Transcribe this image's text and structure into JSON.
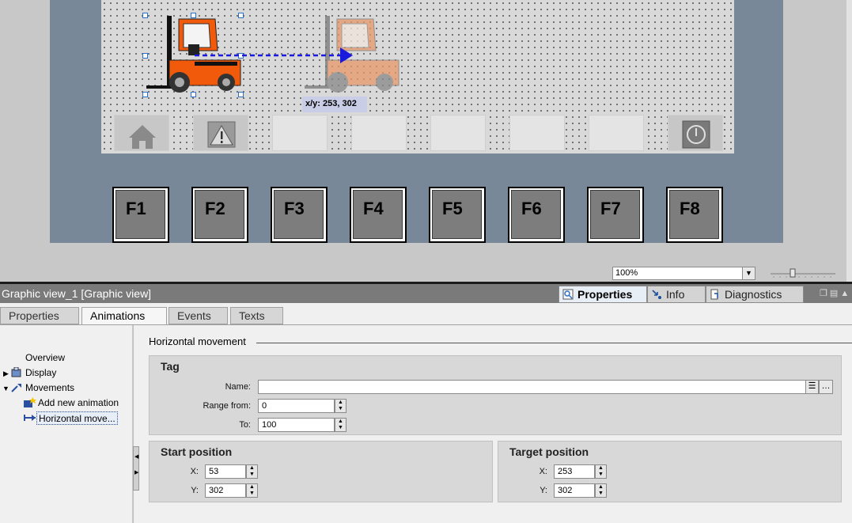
{
  "canvas": {
    "coordinate_readout": "x/y: 253, 302",
    "function_keys": [
      "F1",
      "F2",
      "F3",
      "F4",
      "F5",
      "F6",
      "F7",
      "F8"
    ],
    "soft_key_icons": [
      "home-icon",
      "warning-icon",
      "",
      "",
      "",
      "",
      "",
      "power-icon"
    ],
    "zoom_value": "100%"
  },
  "inspector": {
    "title": "Graphic view_1 [Graphic view]",
    "top_tabs": {
      "properties": "Properties",
      "info": "Info",
      "diagnostics": "Diagnostics"
    },
    "sub_tabs": {
      "properties": "Properties",
      "animations": "Animations",
      "events": "Events",
      "texts": "Texts"
    },
    "tree": {
      "overview": "Overview",
      "display": "Display",
      "movements": "Movements",
      "add_new_animation": "Add new animation",
      "horizontal_movement": "Horizontal move..."
    },
    "section_title": "Horizontal movement",
    "tag_group": {
      "title": "Tag",
      "name_label": "Name:",
      "name_value": "",
      "range_from_label": "Range from:",
      "range_from_value": "0",
      "to_label": "To:",
      "to_value": "100"
    },
    "start_position": {
      "title": "Start position",
      "x_label": "X:",
      "x_value": "53",
      "y_label": "Y:",
      "y_value": "302"
    },
    "target_position": {
      "title": "Target position",
      "x_label": "X:",
      "x_value": "253",
      "y_label": "Y:",
      "y_value": "302"
    }
  },
  "colors": {
    "panel_frame": "#788898",
    "forklift_source": "#f05a0a",
    "forklift_target": "#e89a68",
    "motion_path": "#1a1adc",
    "selection_handle": "#2a6fc9"
  }
}
